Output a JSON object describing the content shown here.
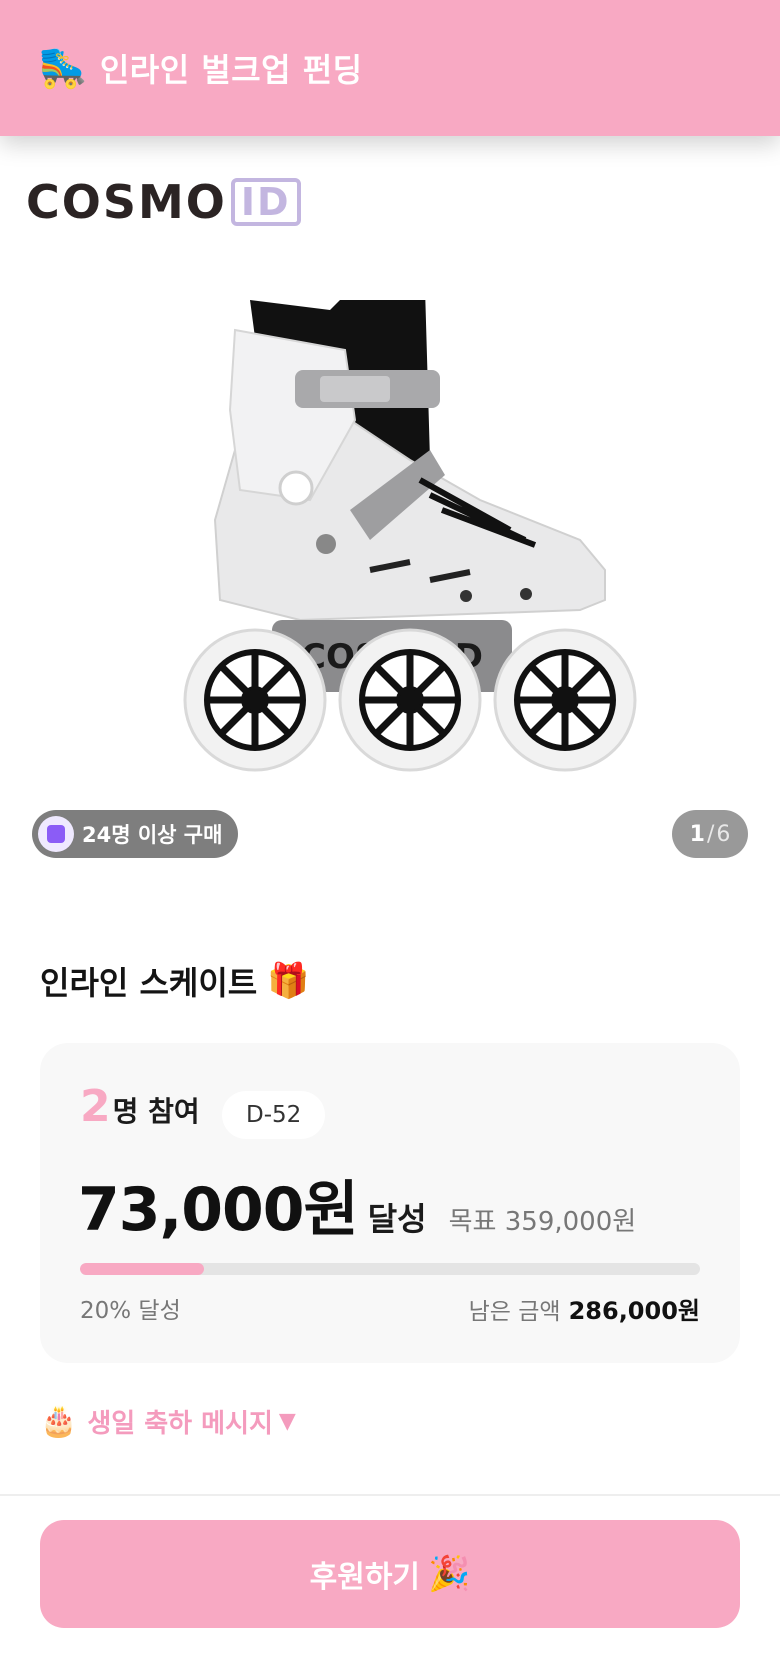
{
  "header": {
    "icon": "🛼",
    "title": "인라인 벌크업 펀딩"
  },
  "brand": {
    "logo_word": "COSMO",
    "logo_id": "ID"
  },
  "gallery": {
    "buyers_badge": "24명 이상 구매",
    "current_page": "1",
    "separator": "/",
    "total_pages": "6",
    "skate_brand_text": "COSMOID"
  },
  "product": {
    "title": "인라인 스케이트",
    "title_emoji": "🎁"
  },
  "funding": {
    "participants_count": "2",
    "participants_label": "명 참여",
    "dday": "D-52",
    "amount": "73,000원",
    "achieved_label": "달성",
    "goal_text": "목표 359,000원",
    "progress_percent": 20,
    "progress_text": "20% 달성",
    "remaining_label": "남은 금액",
    "remaining_value": "286,000원"
  },
  "message_toggle": {
    "icon": "🎂",
    "label": "생일 축하 메시지",
    "caret": "▼"
  },
  "cta": {
    "label": "후원하기",
    "emoji": "🎉"
  },
  "colors": {
    "brand_pink": "#f8a9c3",
    "card_bg": "#f8f8f8",
    "logo_purple": "#c3b6e0"
  }
}
